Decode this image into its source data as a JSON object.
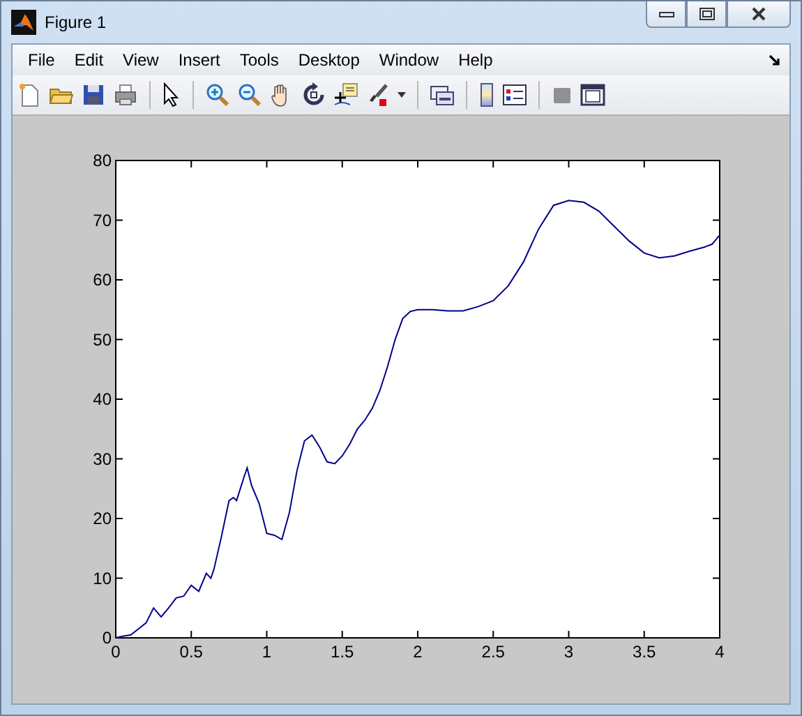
{
  "window": {
    "title": "Figure 1"
  },
  "menu": [
    "File",
    "Edit",
    "View",
    "Insert",
    "Tools",
    "Desktop",
    "Window",
    "Help"
  ],
  "axes": {
    "chart_data": {
      "type": "line",
      "xlim": [
        0,
        4
      ],
      "ylim": [
        0,
        80
      ],
      "xticks": [
        0,
        0.5,
        1,
        1.5,
        2,
        2.5,
        3,
        3.5,
        4
      ],
      "yticks": [
        0,
        10,
        20,
        30,
        40,
        50,
        60,
        70,
        80
      ],
      "x": [
        0,
        0.05,
        0.1,
        0.15,
        0.2,
        0.25,
        0.3,
        0.35,
        0.4,
        0.45,
        0.5,
        0.55,
        0.6,
        0.63,
        0.65,
        0.7,
        0.75,
        0.78,
        0.8,
        0.85,
        0.87,
        0.9,
        0.95,
        1.0,
        1.05,
        1.1,
        1.15,
        1.2,
        1.25,
        1.3,
        1.35,
        1.4,
        1.45,
        1.5,
        1.55,
        1.6,
        1.65,
        1.7,
        1.75,
        1.8,
        1.85,
        1.9,
        1.95,
        2.0,
        2.1,
        2.2,
        2.3,
        2.4,
        2.5,
        2.6,
        2.7,
        2.8,
        2.9,
        3.0,
        3.1,
        3.2,
        3.3,
        3.4,
        3.5,
        3.6,
        3.7,
        3.8,
        3.9,
        3.95,
        4.0
      ],
      "series": [
        {
          "color": "#00008b",
          "values": [
            0,
            0.3,
            0.5,
            1.5,
            2.5,
            5,
            3.5,
            5,
            6.7,
            7,
            8.8,
            7.8,
            10.8,
            10,
            11.5,
            17,
            23,
            23.5,
            23,
            27,
            28.5,
            25.5,
            22.5,
            17.5,
            17.2,
            16.5,
            21,
            28,
            33,
            34,
            32,
            29.5,
            29.2,
            30.5,
            32.5,
            35,
            36.5,
            38.5,
            41.5,
            45.5,
            50,
            53.5,
            54.7,
            55,
            55,
            54.8,
            54.8,
            55.5,
            56.5,
            59,
            63,
            68.5,
            72.5,
            73.3,
            73,
            71.5,
            69,
            66.5,
            64.5,
            63.7,
            64,
            64.8,
            65.5,
            66,
            67.5
          ]
        }
      ]
    }
  }
}
